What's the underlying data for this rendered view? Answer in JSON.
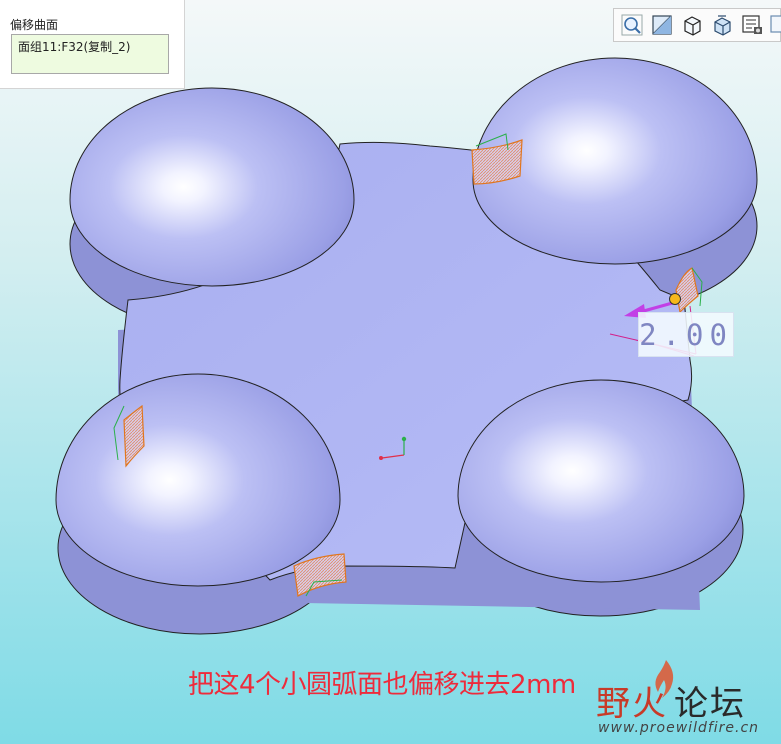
{
  "feature_panel": {
    "title": "偏移曲面",
    "reference_value": "面组11:F32(复制_2)"
  },
  "toolbar": {
    "buttons": [
      {
        "name": "zoom-fit-icon"
      },
      {
        "name": "display-style-icon"
      },
      {
        "name": "saved-orientation-icon"
      },
      {
        "name": "view-manager-icon"
      },
      {
        "name": "annotation-display-icon"
      },
      {
        "name": "spin-center-icon"
      }
    ]
  },
  "dimension": {
    "value": "2.00"
  },
  "caption": {
    "text": "把这4个小圆弧面也偏移进去2mm"
  },
  "watermark": {
    "ye": "野",
    "huo": "火",
    "rest": "论坛",
    "url": "www.proewildfire.cn"
  },
  "colors": {
    "dome": "#9ea4ec",
    "plate_top": "#b4baf5",
    "plate_side": "#8d92d6",
    "caption": "#ee2b3b",
    "drag_arrow": "#c23fe6",
    "handle": "#f6b81c"
  }
}
